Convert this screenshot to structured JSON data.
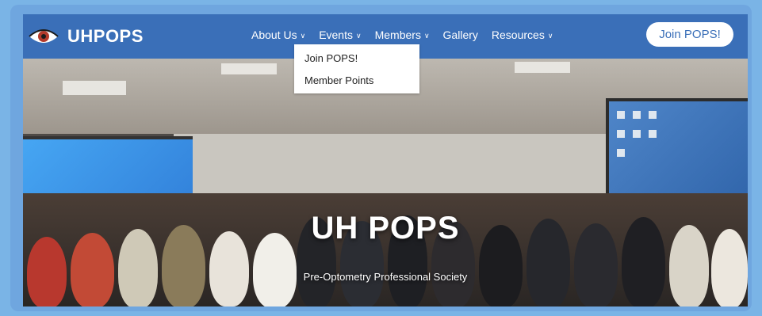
{
  "brand": {
    "name": "UHPOPS",
    "logo_icon": "eye-icon"
  },
  "nav": {
    "items": [
      {
        "label": "About Us",
        "has_dropdown": true
      },
      {
        "label": "Events",
        "has_dropdown": true
      },
      {
        "label": "Members",
        "has_dropdown": true
      },
      {
        "label": "Gallery",
        "has_dropdown": false
      },
      {
        "label": "Resources",
        "has_dropdown": true
      }
    ],
    "join_button": "Join POPS!"
  },
  "dropdown": {
    "parent": "Members",
    "items": [
      {
        "label": "Join POPS!"
      },
      {
        "label": "Member Points"
      }
    ]
  },
  "hero": {
    "title": "UH POPS",
    "subtitle": "Pre-Optometry Professional Society"
  },
  "colors": {
    "navbar": "#3a6fb8",
    "frame": "#6fa6df",
    "page_bg": "#7ab4e6"
  }
}
